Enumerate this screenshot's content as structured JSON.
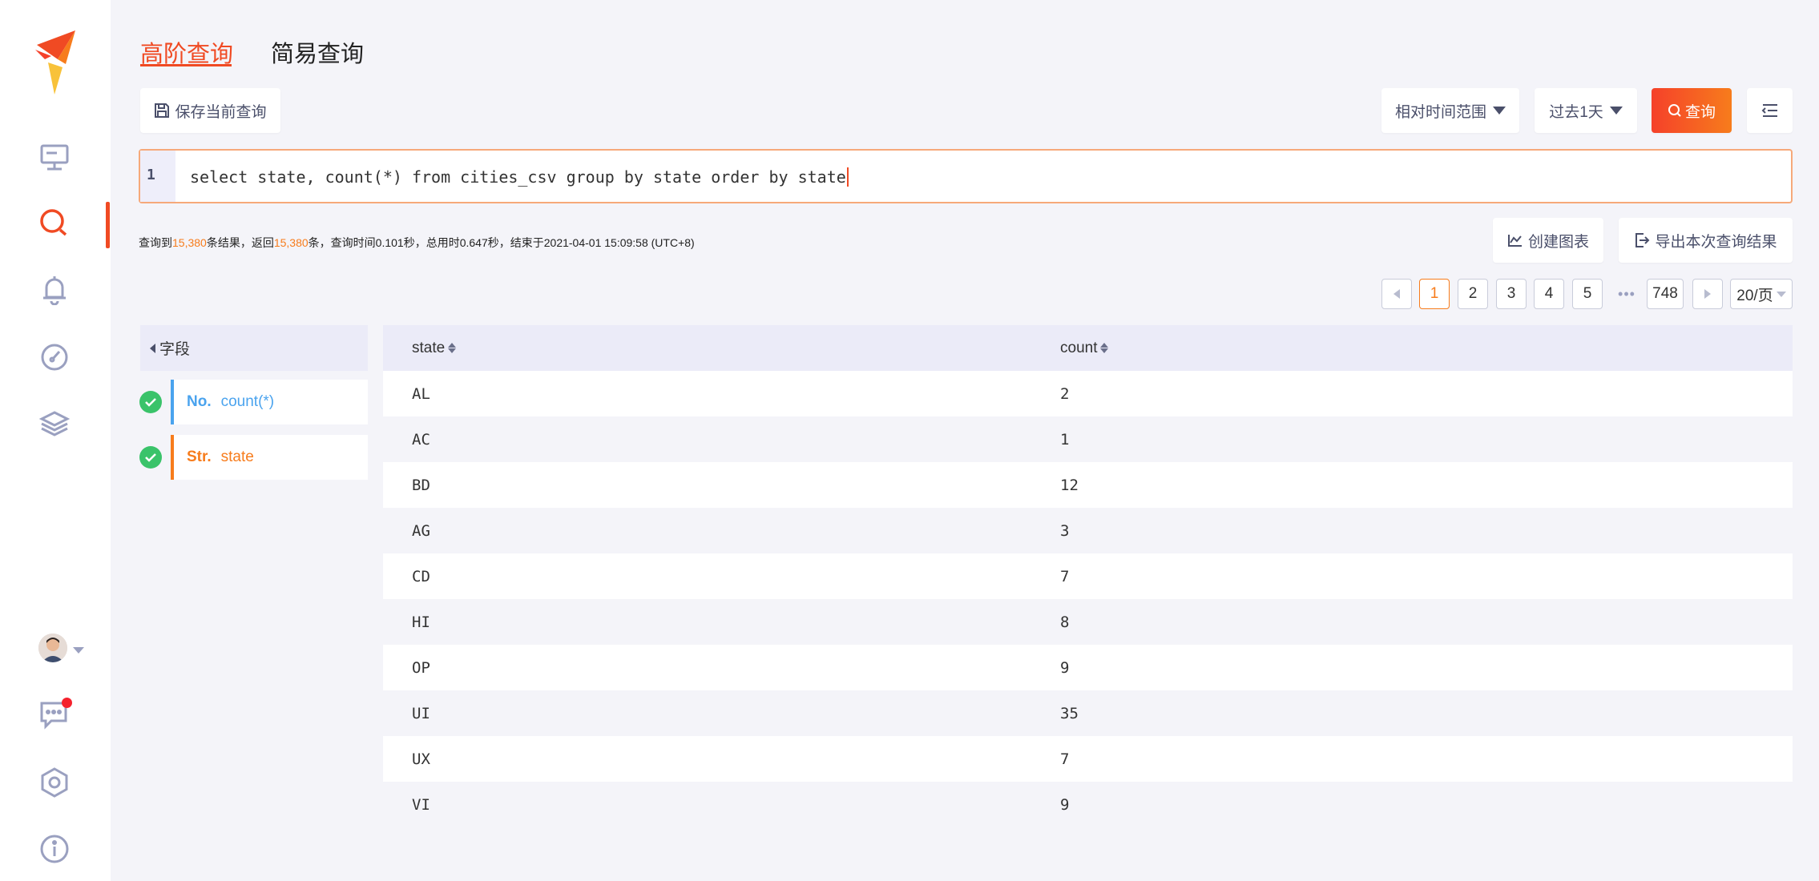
{
  "tabs": {
    "advanced": "高阶查询",
    "simple": "简易查询"
  },
  "toolbar": {
    "save_label": "保存当前查询",
    "time_range_label": "相对时间范围",
    "past_label": "过去1天",
    "query_label": "查询"
  },
  "editor": {
    "line_number": "1",
    "sql": "select state, count(*) from cities_csv group by state order by state"
  },
  "stats": {
    "p1": "查询到",
    "found": "15,380",
    "p2": "条结果，返回",
    "returned": "15,380",
    "p3": "条，查询时间",
    "query_time": "0.101秒",
    "p4": "，总用时",
    "total_time": "0.647秒",
    "p5": "，结束于2021-04-01 15:09:58 (UTC+8)"
  },
  "actions": {
    "chart_label": "创建图表",
    "export_label": "导出本次查询结果"
  },
  "pagination": {
    "pages": [
      "1",
      "2",
      "3",
      "4",
      "5"
    ],
    "ellipsis": "•••",
    "last": "748",
    "page_size": "20/页",
    "current": 1
  },
  "fields": {
    "header": "字段",
    "items": [
      {
        "type": "No.",
        "name": "count(*)"
      },
      {
        "type": "Str.",
        "name": "state"
      }
    ]
  },
  "table": {
    "columns": [
      "state",
      "count"
    ],
    "rows": [
      [
        "AL",
        "2"
      ],
      [
        "AC",
        "1"
      ],
      [
        "BD",
        "12"
      ],
      [
        "AG",
        "3"
      ],
      [
        "CD",
        "7"
      ],
      [
        "HI",
        "8"
      ],
      [
        "OP",
        "9"
      ],
      [
        "UI",
        "35"
      ],
      [
        "UX",
        "7"
      ],
      [
        "VI",
        "9"
      ]
    ]
  },
  "colors": {
    "accent": "#f04a23",
    "accent2": "#f77c1c",
    "number_field": "#4aa3ee",
    "check": "#3ac36a",
    "icon": "#9aa0c0"
  },
  "sidebar": {
    "icons": [
      "logo",
      "monitor-icon",
      "search-icon",
      "bell-icon",
      "dashboard-icon",
      "layers-icon",
      "avatar",
      "chat-icon",
      "settings-icon",
      "info-icon"
    ]
  }
}
